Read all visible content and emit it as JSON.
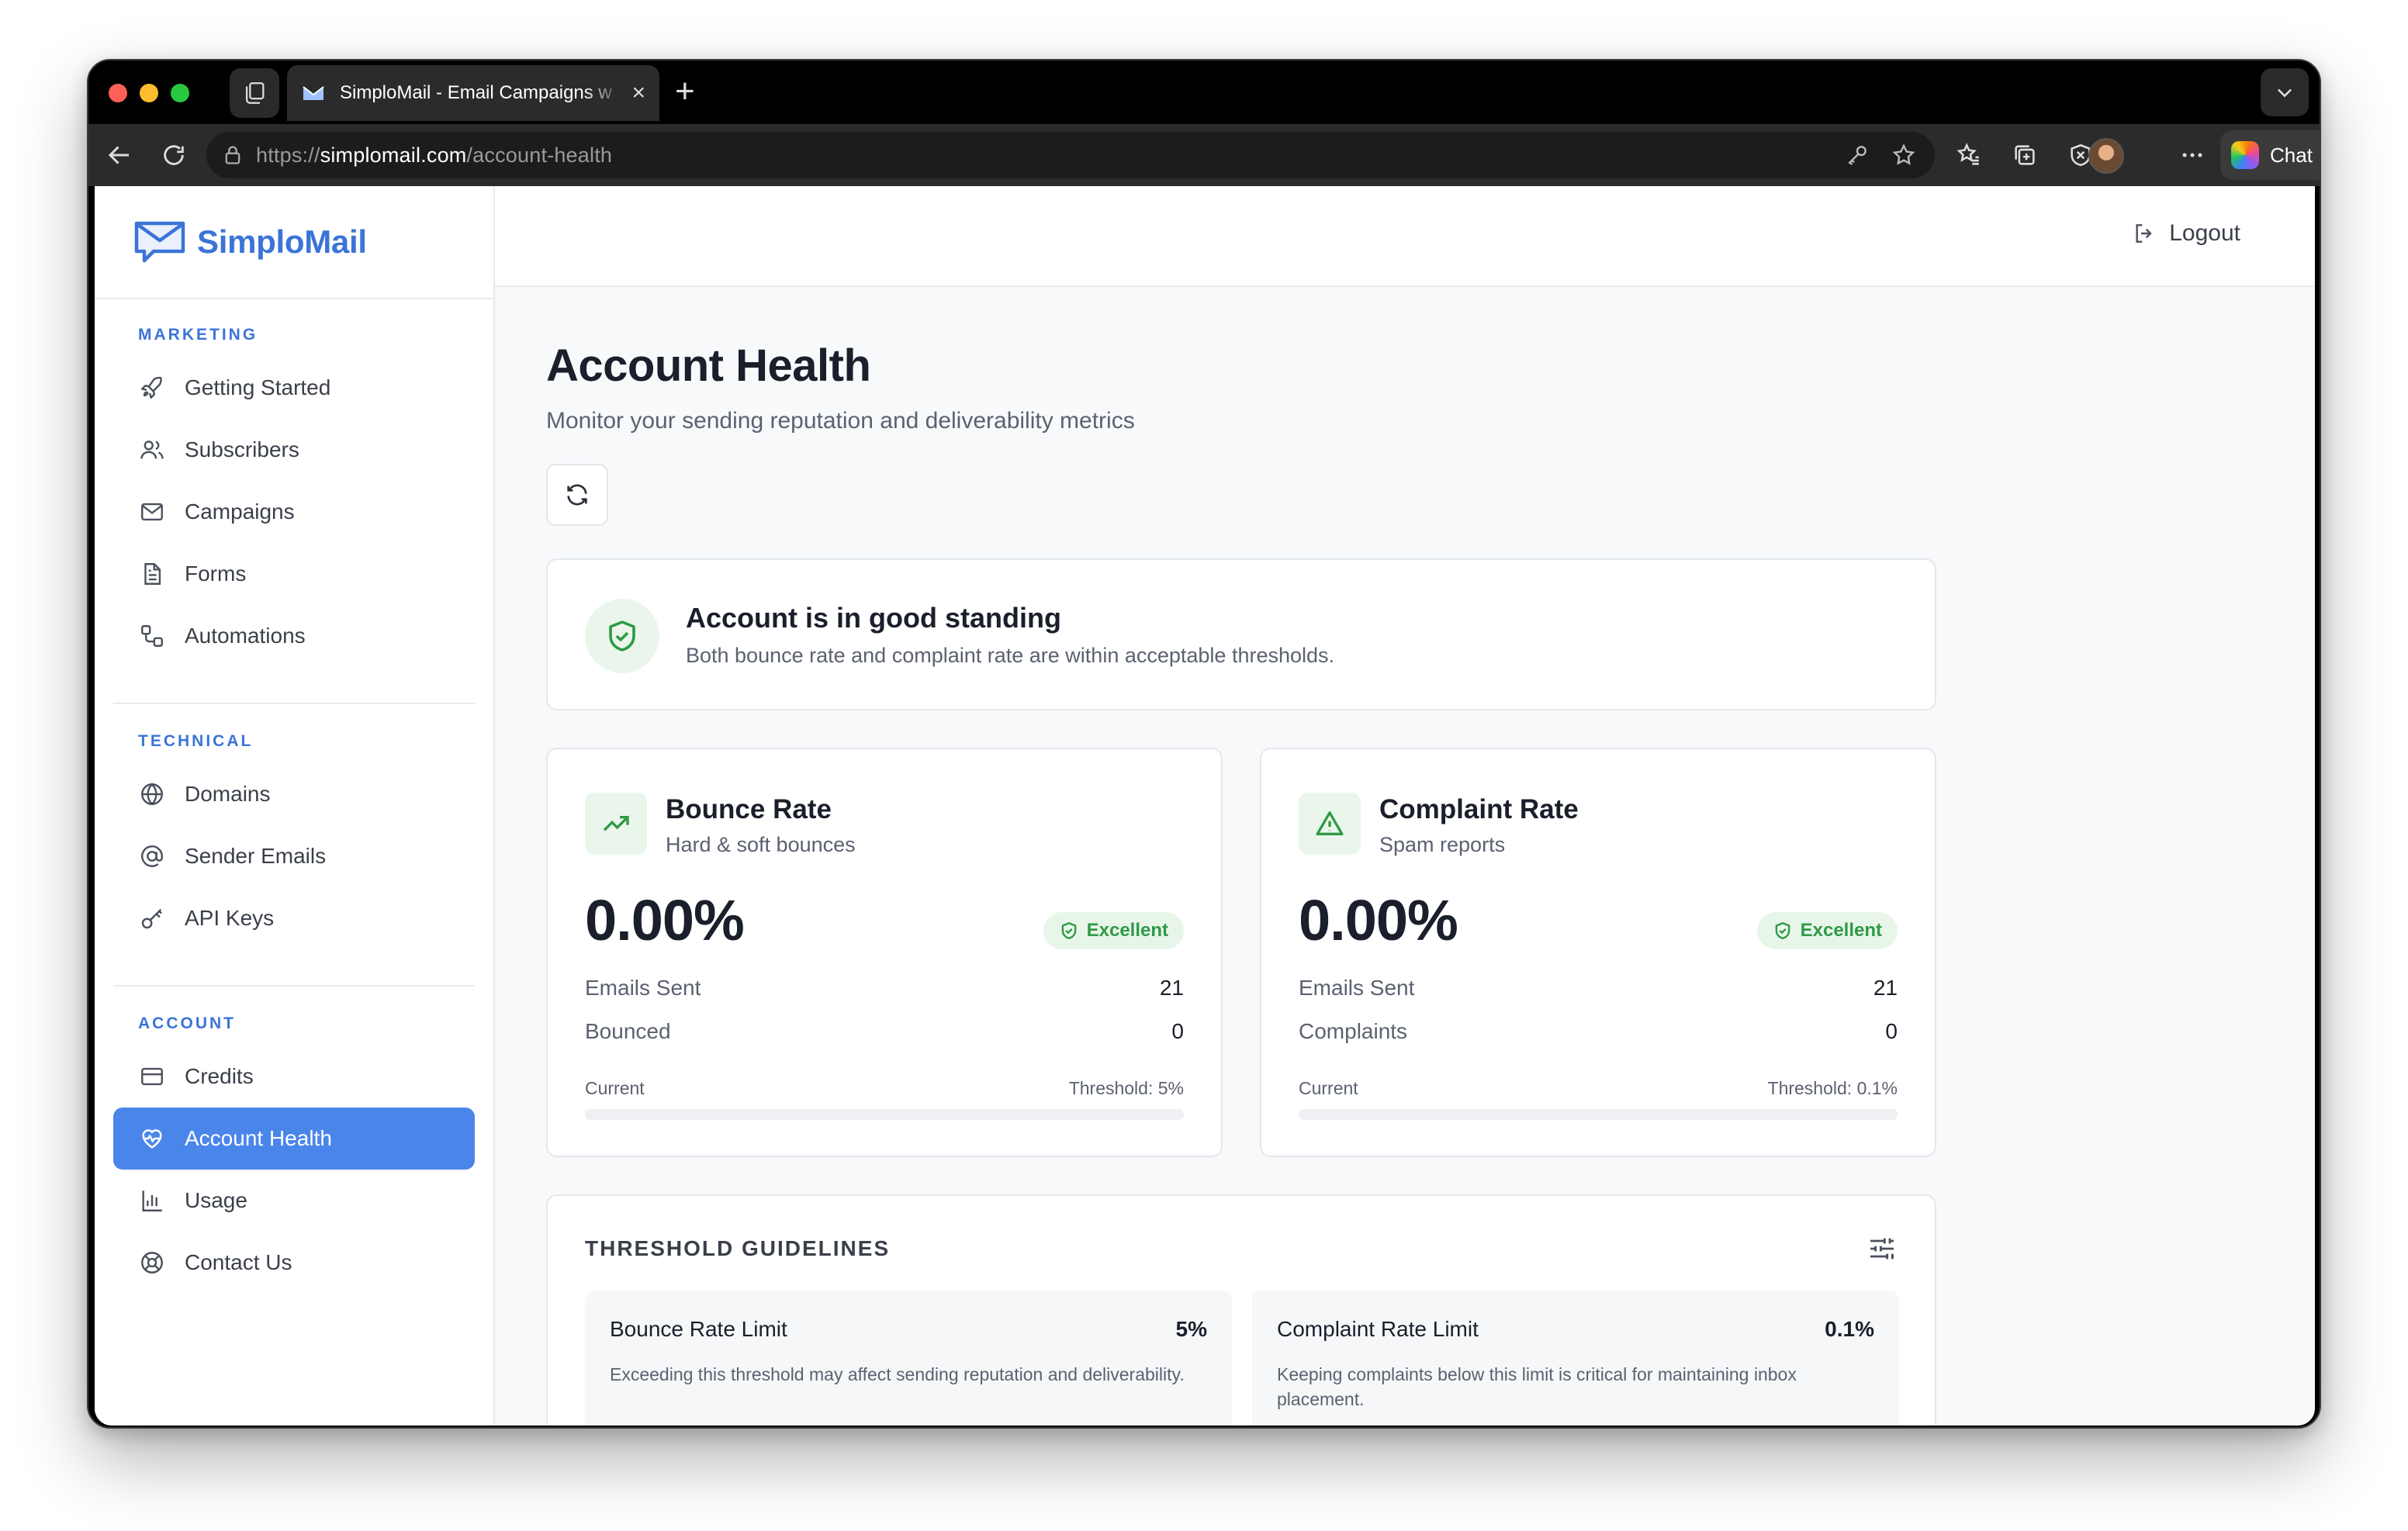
{
  "browser": {
    "tab_title": "SimploMail - Email Campaigns w",
    "url_scheme": "https://",
    "url_host": "simplomail.com",
    "url_path": "/account-health",
    "chat_label": "Chat"
  },
  "brand": {
    "name": "SimploMail",
    "color": "#3b74d8"
  },
  "sidebar": {
    "sections": [
      {
        "label": "MARKETING",
        "items": [
          {
            "label": "Getting Started",
            "icon": "rocket-icon"
          },
          {
            "label": "Subscribers",
            "icon": "users-icon"
          },
          {
            "label": "Campaigns",
            "icon": "mail-icon"
          },
          {
            "label": "Forms",
            "icon": "document-icon"
          },
          {
            "label": "Automations",
            "icon": "workflow-icon"
          }
        ]
      },
      {
        "label": "TECHNICAL",
        "items": [
          {
            "label": "Domains",
            "icon": "globe-icon"
          },
          {
            "label": "Sender Emails",
            "icon": "at-sign-icon"
          },
          {
            "label": "API Keys",
            "icon": "key-icon"
          }
        ]
      },
      {
        "label": "ACCOUNT",
        "items": [
          {
            "label": "Credits",
            "icon": "credit-card-icon"
          },
          {
            "label": "Account Health",
            "icon": "heart-pulse-icon",
            "active": true
          },
          {
            "label": "Usage",
            "icon": "bar-chart-icon"
          },
          {
            "label": "Contact Us",
            "icon": "lifebuoy-icon"
          }
        ]
      }
    ],
    "active_color": "#4a86ea"
  },
  "topbar": {
    "logout_label": "Logout"
  },
  "page": {
    "title": "Account Health",
    "subtitle": "Monitor your sending reputation and deliverability metrics"
  },
  "standing": {
    "title": "Account is in good standing",
    "description": "Both bounce rate and complaint rate are within acceptable thresholds."
  },
  "metrics": {
    "bounce": {
      "title": "Bounce Rate",
      "subtitle": "Hard & soft bounces",
      "value": "0.00%",
      "badge": "Excellent",
      "row1_label": "Emails Sent",
      "row1_value": "21",
      "row2_label": "Bounced",
      "row2_value": "0",
      "current_label": "Current",
      "threshold_label": "Threshold: 5%",
      "progress": 0
    },
    "complaint": {
      "title": "Complaint Rate",
      "subtitle": "Spam reports",
      "value": "0.00%",
      "badge": "Excellent",
      "row1_label": "Emails Sent",
      "row1_value": "21",
      "row2_label": "Complaints",
      "row2_value": "0",
      "current_label": "Current",
      "threshold_label": "Threshold: 0.1%",
      "progress": 0
    }
  },
  "guidelines": {
    "title": "THRESHOLD GUIDELINES",
    "bounce": {
      "title": "Bounce Rate Limit",
      "value": "5%",
      "description": "Exceeding this threshold may affect sending reputation and deliverability."
    },
    "complaint": {
      "title": "Complaint Rate Limit",
      "value": "0.1%",
      "description": "Keeping complaints below this limit is critical for maintaining inbox placement."
    }
  },
  "colors": {
    "success": "#2f9a45",
    "success_bg": "#e8f6ea"
  }
}
